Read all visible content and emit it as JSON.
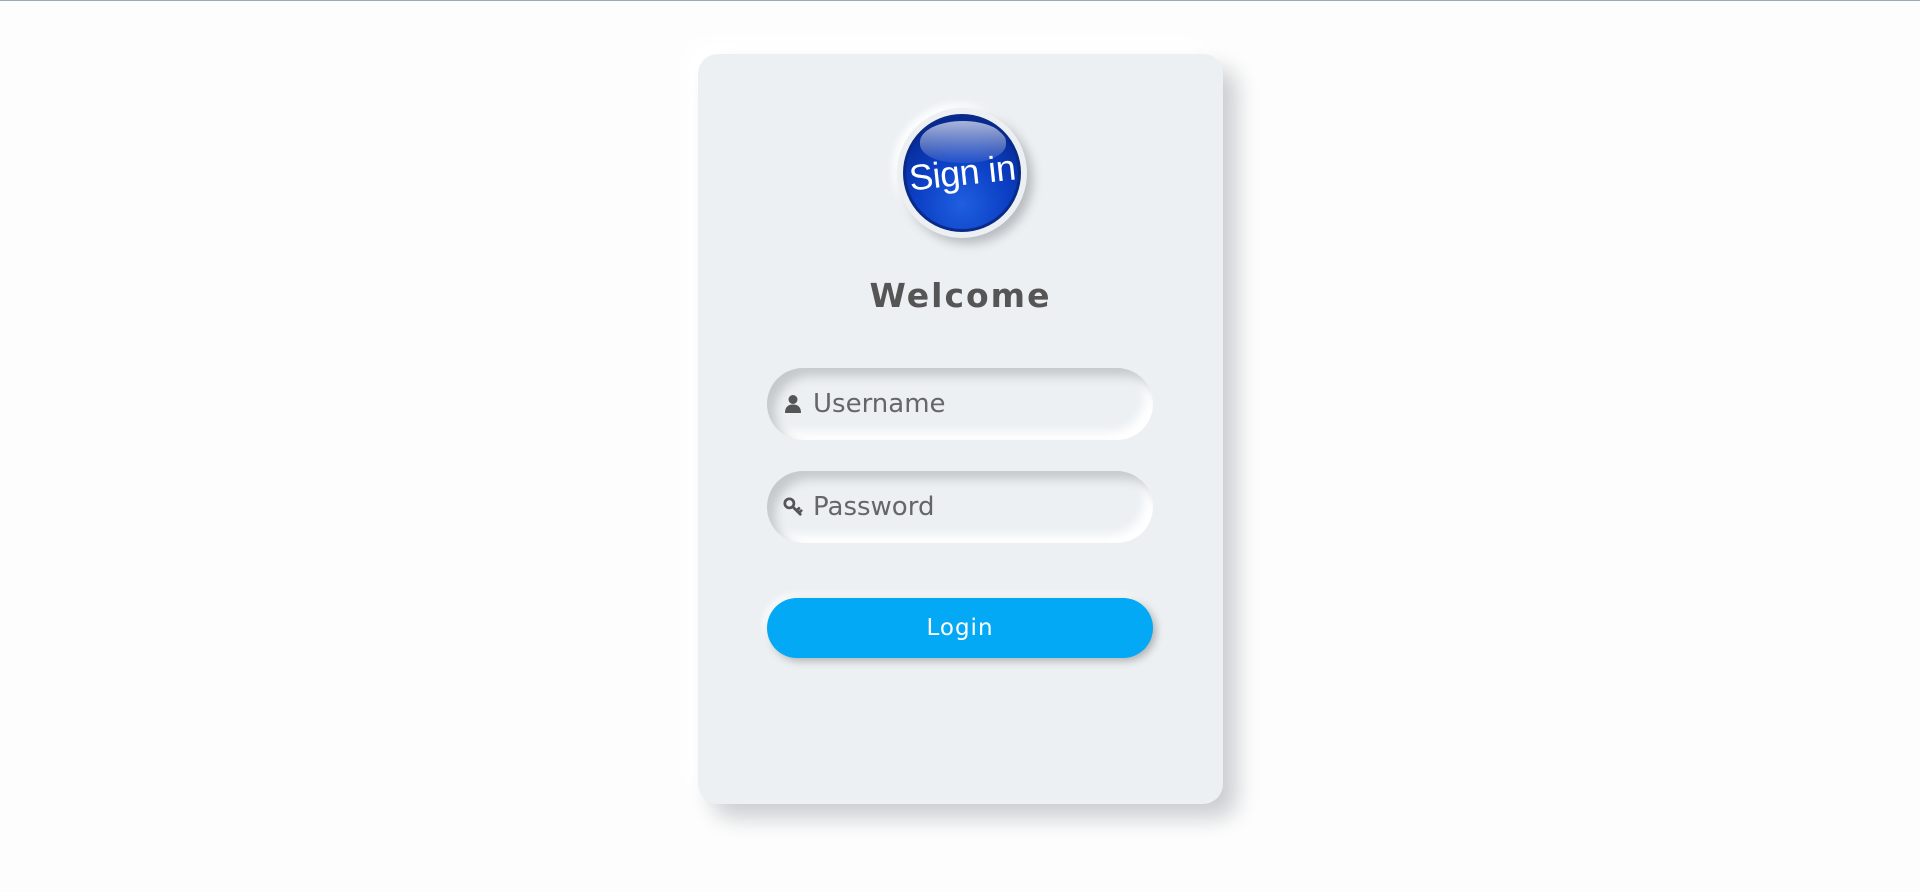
{
  "logo": {
    "text": "Sign in",
    "icon": "sign-in-badge",
    "color": "#0b3fc4"
  },
  "title": "Welcome",
  "username": {
    "placeholder": "Username",
    "value": "",
    "icon": "user-icon"
  },
  "password": {
    "placeholder": "Password",
    "value": "",
    "icon": "key-icon"
  },
  "login_button": {
    "label": "Login",
    "color": "#03a9f4"
  }
}
